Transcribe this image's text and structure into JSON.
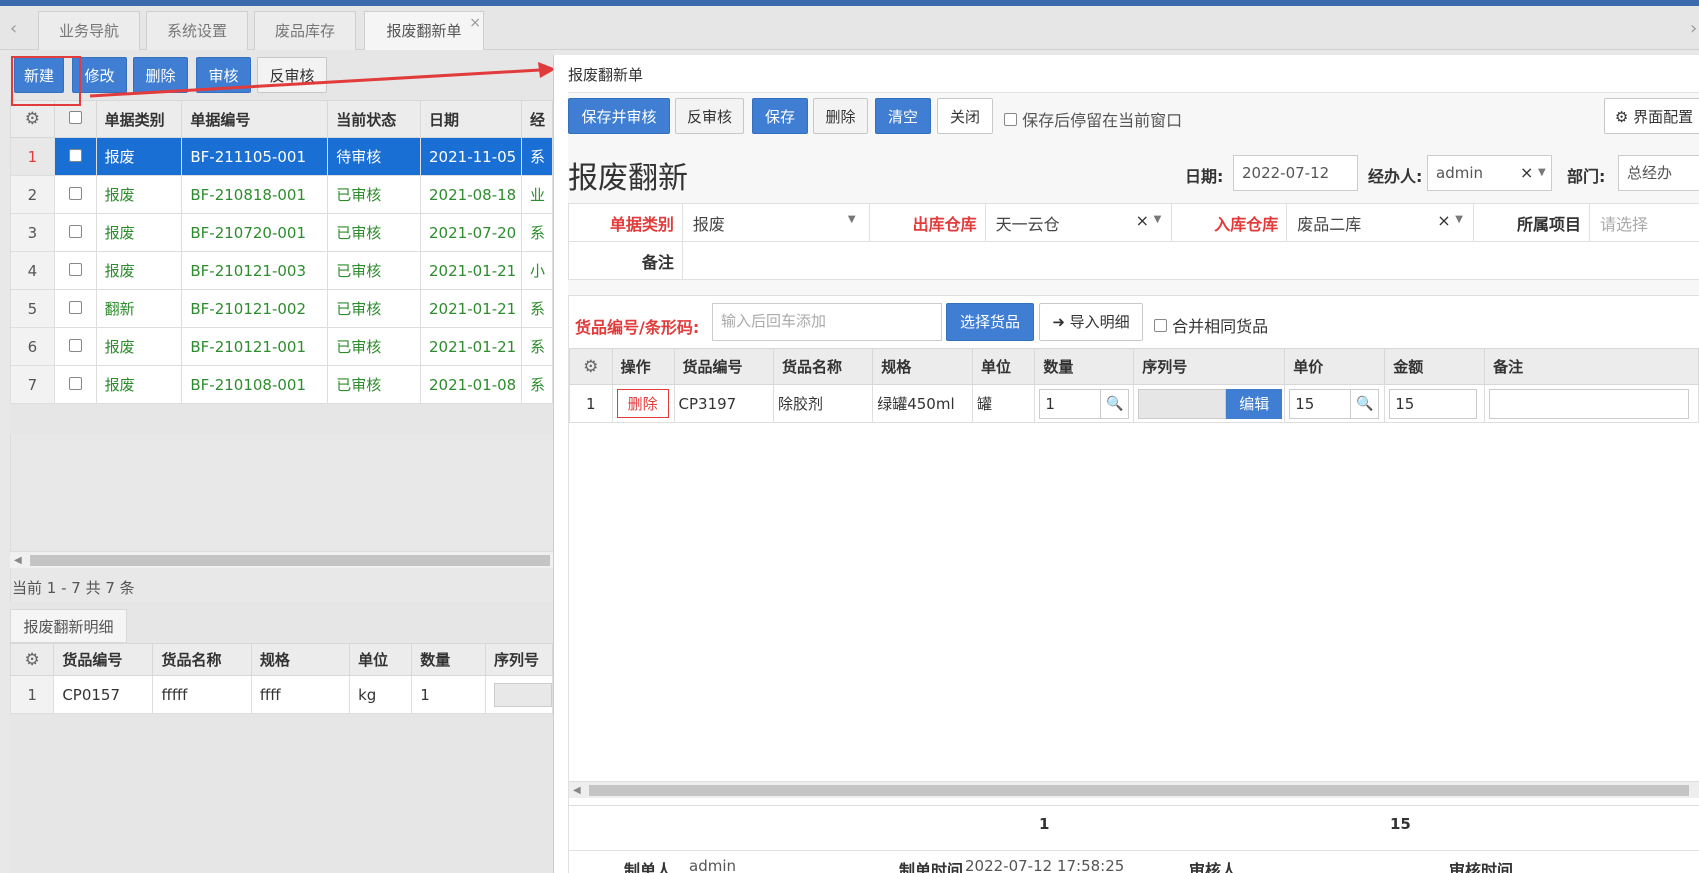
{
  "tabs": [
    "业务导航",
    "系统设置",
    "废品库存",
    "报废翻新单"
  ],
  "tab_close": "×",
  "toolbar": {
    "new": "新建",
    "edit": "修改",
    "delete": "删除",
    "audit": "审核",
    "unaudit": "反审核"
  },
  "list": {
    "headers": [
      "单据类别",
      "单据编号",
      "当前状态",
      "日期",
      "经"
    ],
    "rows": [
      {
        "idx": "1",
        "type": "报废",
        "code": "BF-211105-001",
        "status": "待审核",
        "date": "2021-11-05",
        "extra": "系"
      },
      {
        "idx": "2",
        "type": "报废",
        "code": "BF-210818-001",
        "status": "已审核",
        "date": "2021-08-18",
        "extra": "业"
      },
      {
        "idx": "3",
        "type": "报废",
        "code": "BF-210720-001",
        "status": "已审核",
        "date": "2021-07-20",
        "extra": "系"
      },
      {
        "idx": "4",
        "type": "报废",
        "code": "BF-210121-003",
        "status": "已审核",
        "date": "2021-01-21",
        "extra": "小"
      },
      {
        "idx": "5",
        "type": "翻新",
        "code": "BF-210121-002",
        "status": "已审核",
        "date": "2021-01-21",
        "extra": "系"
      },
      {
        "idx": "6",
        "type": "报废",
        "code": "BF-210121-001",
        "status": "已审核",
        "date": "2021-01-21",
        "extra": "系"
      },
      {
        "idx": "7",
        "type": "报废",
        "code": "BF-210108-001",
        "status": "已审核",
        "date": "2021-01-08",
        "extra": "系"
      }
    ]
  },
  "pager": "当前 1 - 7 共 7 条",
  "subtab": "报废翻新明细",
  "sublist": {
    "headers": [
      "货品编号",
      "货品名称",
      "规格",
      "单位",
      "数量",
      "序列号"
    ],
    "rows": [
      {
        "idx": "1",
        "code": "CP0157",
        "name": "fffff",
        "spec": "ffff",
        "unit": "kg",
        "qty": "1"
      }
    ]
  },
  "dialog": {
    "title": "报废翻新单",
    "btn_save_audit": "保存并审核",
    "btn_unaudit": "反审核",
    "btn_save": "保存",
    "btn_delete": "删除",
    "btn_clear": "清空",
    "btn_close": "关闭",
    "stay_label": "保存后停留在当前窗口",
    "ui_config": "界面配置",
    "page_title": "报废翻新",
    "date_label": "日期:",
    "date_value": "2022-07-12",
    "handler_label": "经办人:",
    "handler_value": "admin",
    "dept_label": "部门:",
    "dept_value": "总经办",
    "type_label": "单据类别",
    "type_value": "报废",
    "out_wh_label": "出库仓库",
    "out_wh_value": "天一云仓",
    "in_wh_label": "入库仓库",
    "in_wh_value": "废品二库",
    "project_label": "所属项目",
    "project_placeholder": "请选择",
    "remark_label": "备注",
    "barcode_label": "货品编号/条形码:",
    "barcode_placeholder": "输入后回车添加",
    "choose_goods": "选择货品",
    "import_detail": "导入明细",
    "merge_label": "合并相同货品",
    "detail_headers": [
      "操作",
      "货品编号",
      "货品名称",
      "规格",
      "单位",
      "数量",
      "序列号",
      "单价",
      "金额",
      "备注"
    ],
    "detail_row": {
      "idx": "1",
      "action": "删除",
      "code": "CP3197",
      "name": "除胶剂",
      "spec": "绿罐450ml",
      "unit": "罐",
      "qty": "1",
      "edit": "编辑",
      "price": "15",
      "amount": "15"
    },
    "total_qty": "1",
    "total_amount": "15",
    "creator_label": "制单人",
    "creator_value": "admin",
    "create_time_label": "制单时间",
    "create_time_value": "2022-07-12 17:58:25",
    "auditor_label": "审核人",
    "audit_time_label": "审核时间"
  },
  "colors": {
    "accent": "#3f7ed2",
    "selected": "#1a6fd5",
    "required": "#e23b3b",
    "approved": "#2d8c2d"
  }
}
